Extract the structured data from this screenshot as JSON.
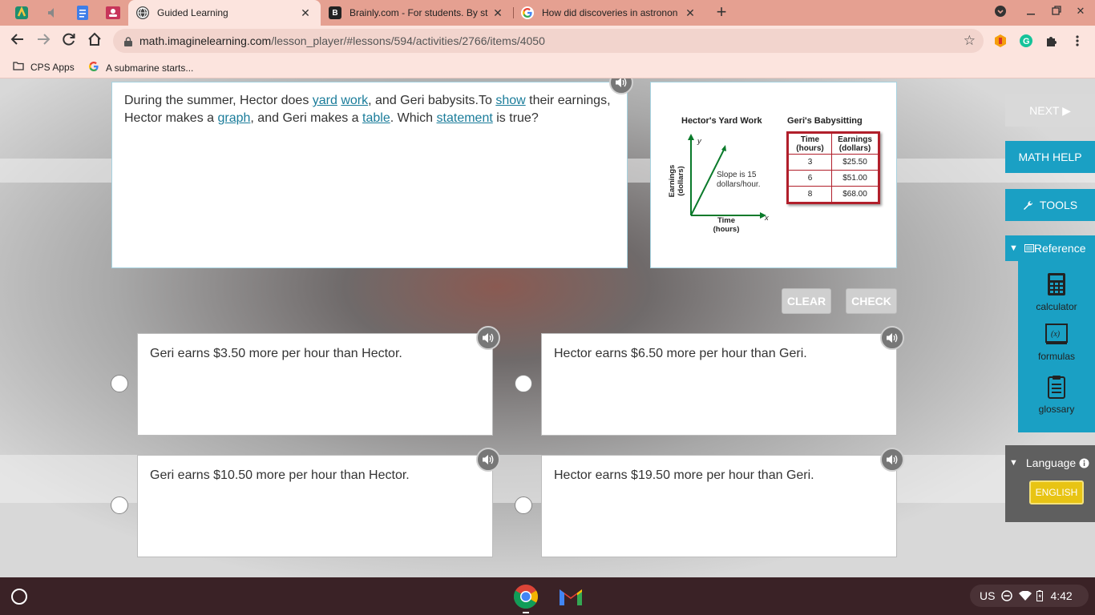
{
  "browser": {
    "tabs": [
      {
        "title": "Guided Learning",
        "active": true
      },
      {
        "title": "Brainly.com - For students. By st",
        "active": false
      },
      {
        "title": "How did discoveries in astronon",
        "active": false
      }
    ],
    "url_host": "math.imaginelearning.com",
    "url_path": "/lesson_player/#lessons/594/activities/2766/items/4050",
    "bookmarks": [
      "CPS Apps",
      "A submarine starts..."
    ]
  },
  "question": {
    "segments": [
      {
        "text": "During the summer, Hector does ",
        "link": false
      },
      {
        "text": "yard",
        "link": true
      },
      {
        "text": " ",
        "link": false
      },
      {
        "text": "work",
        "link": true
      },
      {
        "text": ", and Geri babysits.To ",
        "link": false
      },
      {
        "text": "show",
        "link": true
      },
      {
        "text": " their earnings, Hector makes a ",
        "link": false
      },
      {
        "text": "graph",
        "link": true
      },
      {
        "text": ", and Geri makes a ",
        "link": false
      },
      {
        "text": "table",
        "link": true
      },
      {
        "text": ". Which ",
        "link": false
      },
      {
        "text": "statement",
        "link": true
      },
      {
        "text": " is true?",
        "link": false
      }
    ]
  },
  "figure": {
    "graph_title": "Hector's Yard Work",
    "y_axis_label_1": "Earnings",
    "y_axis_label_2": "(dollars)",
    "x_axis_label_1": "Time",
    "x_axis_label_2": "(hours)",
    "y_letter": "y",
    "x_letter": "x",
    "slope_note_1": "Slope is 15",
    "slope_note_2": "dollars/hour.",
    "table_title": "Geri's Babysitting",
    "table_headers": [
      [
        "Time",
        "(hours)"
      ],
      [
        "Earnings",
        "(dollars)"
      ]
    ],
    "table_rows": [
      [
        "3",
        "$25.50"
      ],
      [
        "6",
        "$51.00"
      ],
      [
        "8",
        "$68.00"
      ]
    ]
  },
  "actions": {
    "clear": "CLEAR",
    "check": "CHECK"
  },
  "choices": [
    "Geri earns $3.50 more per hour than Hector.",
    "Hector earns $6.50 more per hour than Geri.",
    "Geri earns $10.50 more per hour than Hector.",
    "Hector earns $19.50 more per hour than Geri."
  ],
  "rail": {
    "next": "NEXT ▶",
    "math_help": "MATH HELP",
    "tools": "TOOLS",
    "reference": "Reference",
    "reference_items": [
      "calculator",
      "formulas",
      "glossary"
    ],
    "language": "Language",
    "english": "ENGLISH"
  },
  "shelf": {
    "locale": "US",
    "time": "4:42"
  },
  "colors": {
    "accent": "#1aa0c4",
    "tab_strip": "#e5a091",
    "link": "#1a7c9a",
    "table_border": "#b11f2b"
  }
}
